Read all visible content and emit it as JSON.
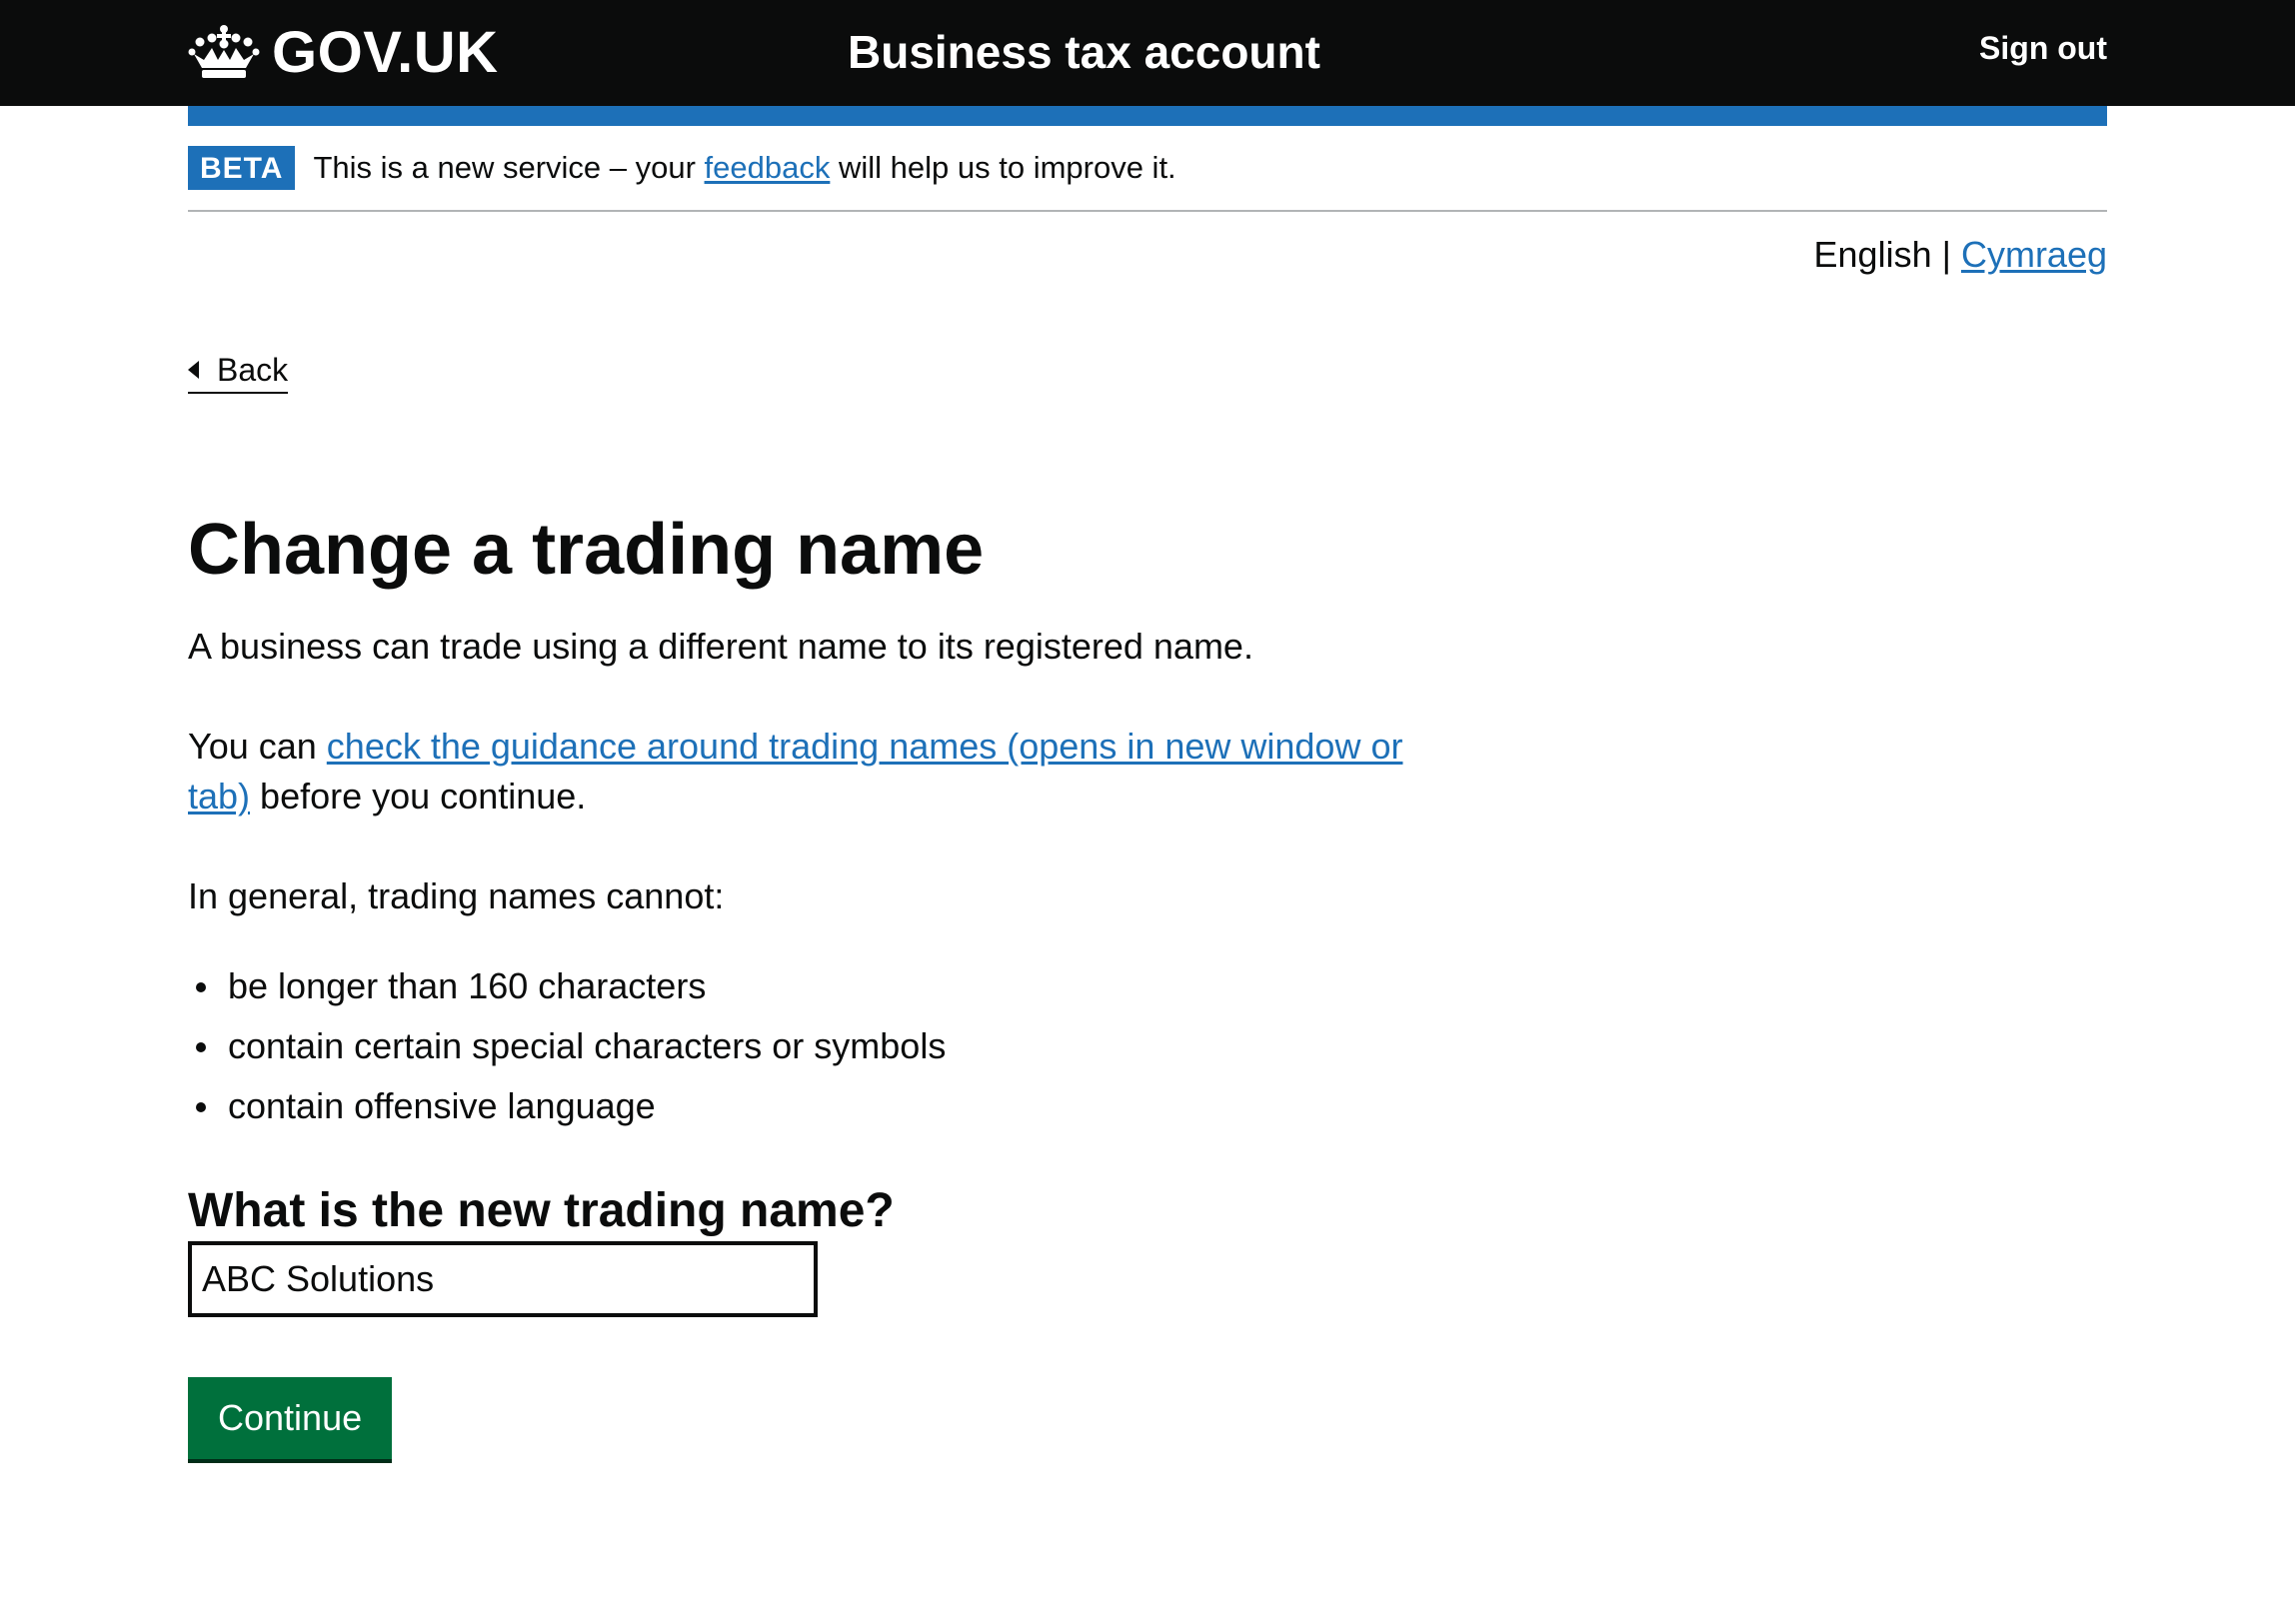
{
  "header": {
    "logo_text": "GOV.UK",
    "service_name": "Business tax account",
    "sign_out_label": "Sign out"
  },
  "phase_banner": {
    "tag": "BETA",
    "text_before": "This is a new service – your ",
    "link_text": "feedback",
    "text_after": " will help us to improve it."
  },
  "language": {
    "current": "English",
    "separator": " | ",
    "alternate": "Cymraeg"
  },
  "back_link": {
    "label": "Back"
  },
  "main": {
    "title": "Change a trading name",
    "intro": "A business can trade using a different name to its registered name.",
    "guidance_before": "You can ",
    "guidance_link": "check the guidance around trading names (opens in new window or tab)",
    "guidance_after": " before you continue.",
    "general_heading": "In general, trading names cannot:",
    "rules": [
      "be longer than 160 characters",
      "contain certain special characters or symbols",
      "contain offensive language"
    ],
    "question_label": "What is the new trading name?",
    "input_value": "ABC Solutions",
    "continue_label": "Continue"
  },
  "colors": {
    "header_bg": "#0b0c0c",
    "brand_blue": "#1d70b8",
    "button_green": "#00703c",
    "text": "#0b0c0c",
    "border_grey": "#b1b4b6"
  },
  "icons": {
    "logo": "crown-icon",
    "back": "chevron-left-icon"
  }
}
